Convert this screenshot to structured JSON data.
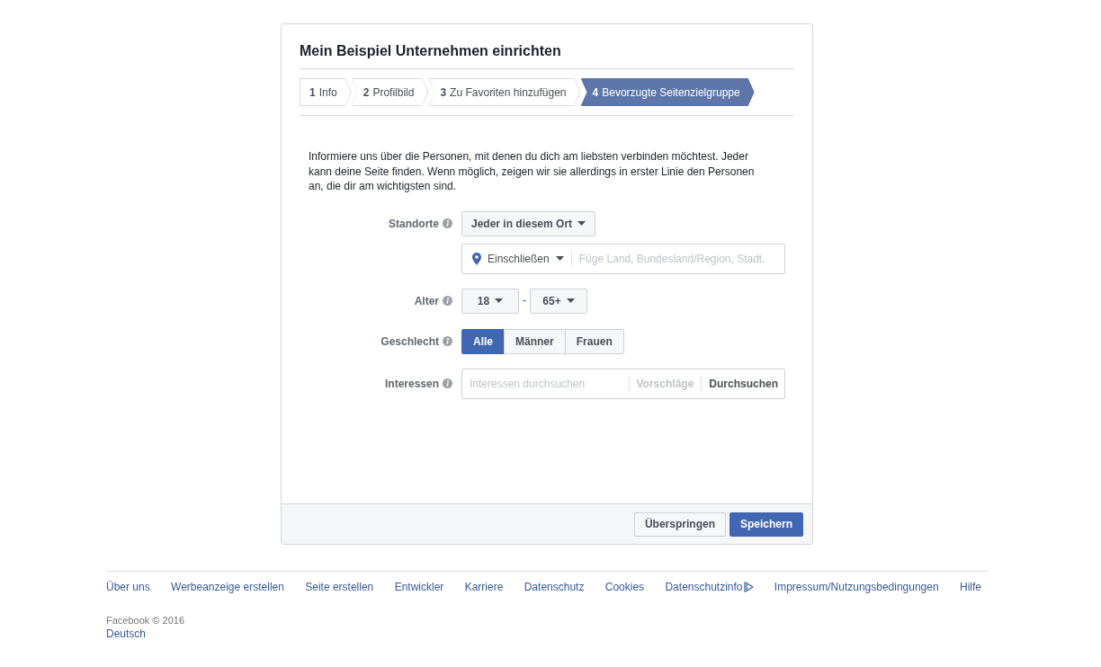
{
  "dialog": {
    "title": "Mein Beispiel Unternehmen einrichten",
    "steps": [
      {
        "number": "1",
        "label": "Info",
        "selected": false
      },
      {
        "number": "2",
        "label": "Profilbild",
        "selected": false
      },
      {
        "number": "3",
        "label": "Zu Favoriten hinzufügen",
        "selected": false
      },
      {
        "number": "4",
        "label": "Bevorzugte Seitenzielgruppe",
        "selected": true
      }
    ],
    "intro": "Informiere uns über die Personen, mit denen du dich am liebsten verbinden möchtest. Jeder kann deine Seite finden. Wenn möglich, zeigen wir sie allerdings in erster Linie den Personen an, die dir am wichtigsten sind.",
    "form": {
      "location": {
        "label": "Standorte",
        "scope": "Jeder in diesem Ort",
        "mode": "Einschließen",
        "placeholder": "Füge Land, Bundesland/Region, Stadt."
      },
      "age": {
        "label": "Alter",
        "min": "18",
        "separator": "-",
        "max": "65+"
      },
      "gender": {
        "label": "Geschlecht",
        "options": [
          {
            "label": "Alle",
            "selected": true
          },
          {
            "label": "Männer",
            "selected": false
          },
          {
            "label": "Frauen",
            "selected": false
          }
        ]
      },
      "interests": {
        "label": "Interessen",
        "placeholder": "Interessen durchsuchen",
        "links": [
          {
            "label": "Vorschläge",
            "disabled": true
          },
          {
            "label": "Durchsuchen",
            "disabled": false
          }
        ]
      }
    },
    "buttons": [
      {
        "label": "Überspringen",
        "kind": "secondary"
      },
      {
        "label": "Speichern",
        "kind": "primary"
      }
    ]
  },
  "footer": {
    "links": [
      {
        "label": "Über uns"
      },
      {
        "label": "Werbeanzeige erstellen"
      },
      {
        "label": "Seite erstellen"
      },
      {
        "label": "Entwickler"
      },
      {
        "label": "Karriere"
      },
      {
        "label": "Datenschutz"
      },
      {
        "label": "Cookies"
      },
      {
        "label": "Datenschutzinfo",
        "ad_choices": true
      },
      {
        "label": "Impressum/Nutzungsbedingungen"
      },
      {
        "label": "Hilfe"
      }
    ],
    "copyright": "Facebook © 2016",
    "language": "Deutsch"
  }
}
